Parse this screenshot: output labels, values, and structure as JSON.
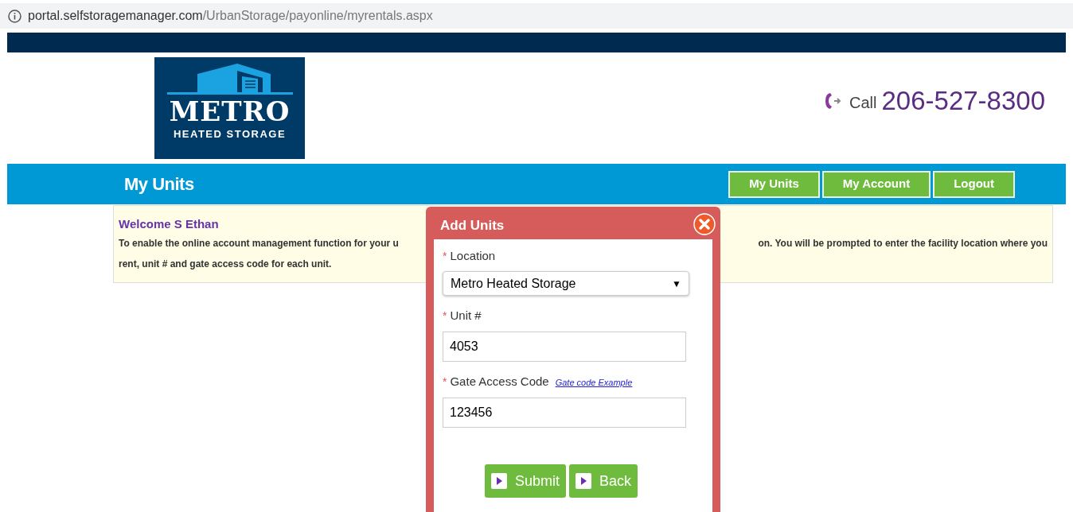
{
  "address_bar": {
    "host": "portal.selfstoragemanager.com",
    "path": "/UrbanStorage/payonline/myrentals.aspx"
  },
  "logo": {
    "name": "METRO",
    "tagline": "HEATED STORAGE"
  },
  "phone": {
    "label": "Call",
    "number": "206-527-8300"
  },
  "page_title": "My Units",
  "nav": [
    {
      "label": "My Units"
    },
    {
      "label": "My Account"
    },
    {
      "label": "Logout"
    }
  ],
  "welcome": {
    "title": "Welcome S Ethan",
    "text_left": "To enable the online account management function for your u",
    "text_right": "on. You will be prompted to enter the facility location where you",
    "text_line2": "rent, unit # and gate access code for each unit."
  },
  "dialog": {
    "title": "Add Units",
    "fields": [
      {
        "kind": "select",
        "label": "Location",
        "required_mark": "*",
        "value": "Metro Heated Storage",
        "arrow": "▼"
      },
      {
        "kind": "text",
        "label": "Unit #",
        "required_mark": "*",
        "value": "4053"
      },
      {
        "kind": "text",
        "label": "Gate Access Code",
        "required_mark": "*",
        "link": "Gate code Example",
        "value": "123456"
      }
    ],
    "buttons": [
      {
        "label": "Submit"
      },
      {
        "label": "Back"
      }
    ]
  }
}
